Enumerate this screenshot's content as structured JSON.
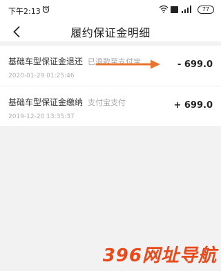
{
  "status_bar": {
    "time": "下午2:13",
    "battery": "77",
    "icons": [
      "alarm-icon",
      "wifi-icon",
      "hd-icon",
      "signal-icon",
      "battery-icon"
    ]
  },
  "nav": {
    "title": "履约保证金明细",
    "back_icon": "chevron-left-icon"
  },
  "items": [
    {
      "title": "基础车型保证金退还",
      "status": "已退款至支付宝",
      "time": "2020-01-29 01:25:46",
      "amount": "- 699.0"
    },
    {
      "title": "基础车型保证金缴纳",
      "status": "支付宝支付",
      "time": "2019-12-20 13:35:37",
      "amount": "+ 699.0"
    }
  ],
  "watermark": "396网址导航",
  "colors": {
    "arrow": "#e8742e",
    "watermark": "#e94a1c",
    "page_bg": "#f2f2f2",
    "card_bg": "#ffffff"
  }
}
